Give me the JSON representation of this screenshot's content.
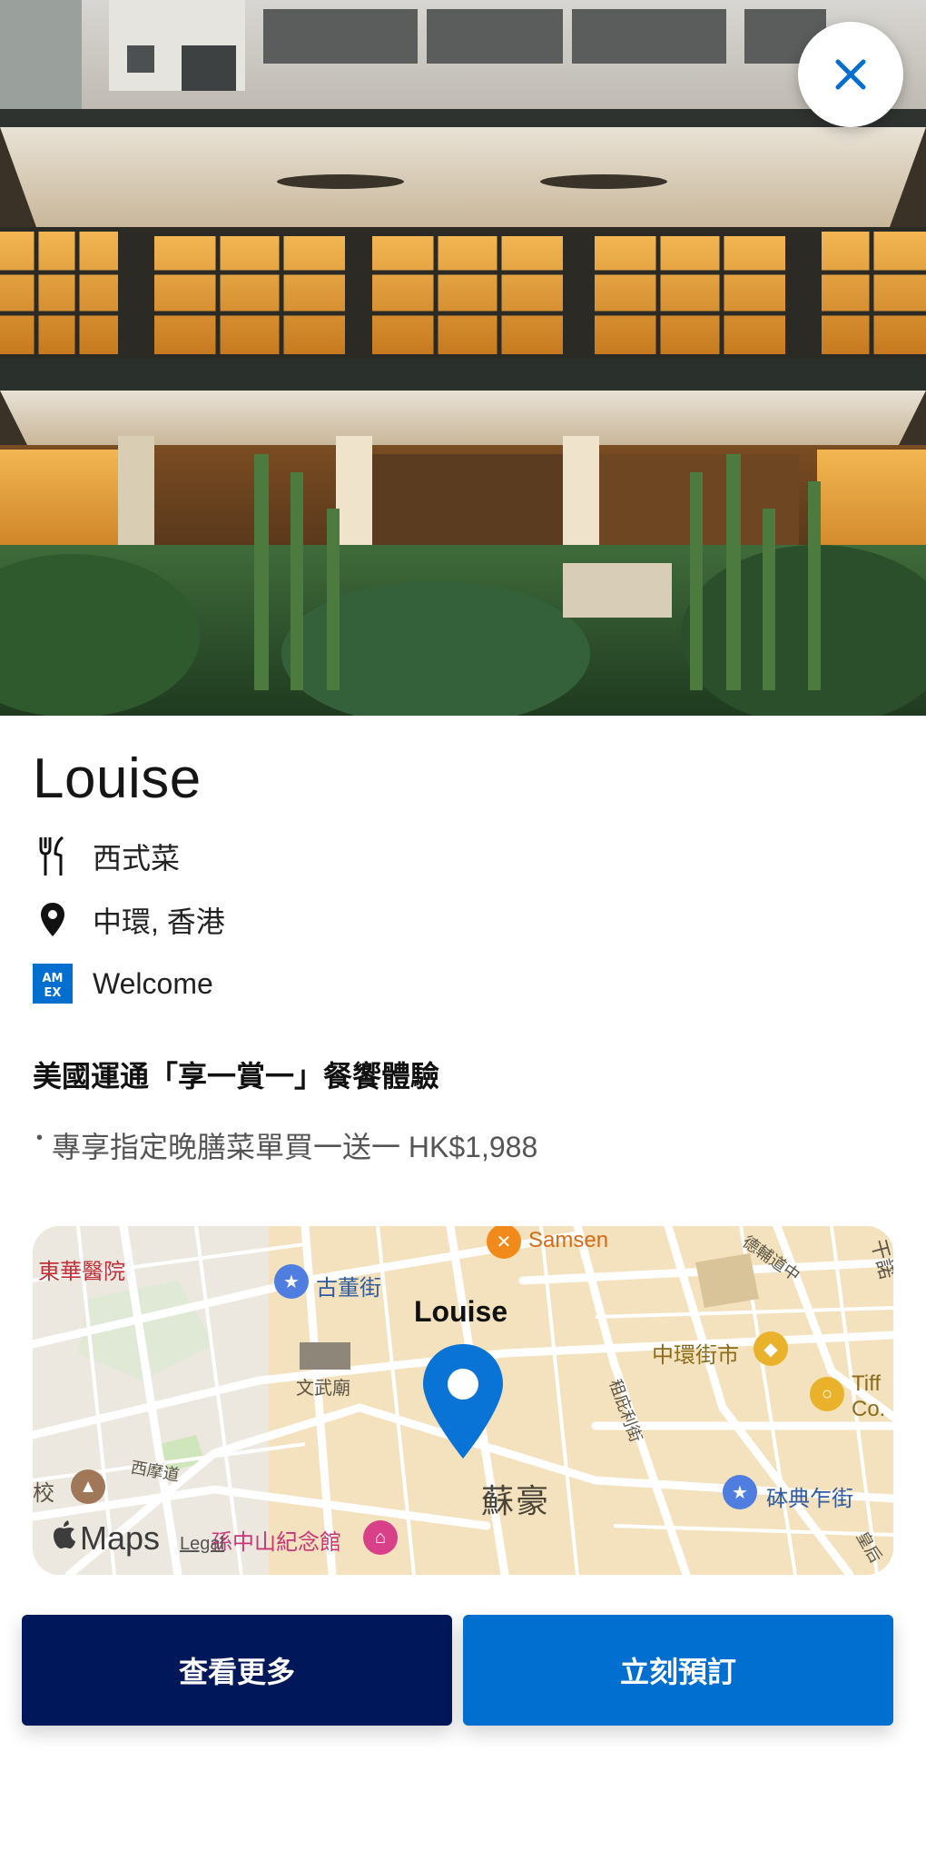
{
  "hero": {
    "image_alt": "restaurant-exterior-photo",
    "close_icon": "close-icon"
  },
  "restaurant": {
    "name": "Louise",
    "cuisine": "西式菜",
    "location": "中環, 香港",
    "card_program": "Welcome",
    "icons": {
      "cuisine": "fork-knife-icon",
      "location": "location-pin-icon",
      "card": "amex-logo-icon"
    }
  },
  "offer": {
    "title": "美國運通「享一賞一」餐饗體驗",
    "items": [
      "專享指定晚膳菜單買一送一 HK$1,988"
    ]
  },
  "map": {
    "pin_label": "Louise",
    "district": "蘇豪",
    "places": {
      "hospital": "東華醫院",
      "samsen": "Samsen",
      "gutongjie": "古董街",
      "temple": "文武廟",
      "central_market": "中環街市",
      "tiffany_line1": "Tiff",
      "tiffany_line2": "Co.",
      "western_street": "西摩道",
      "school": "校",
      "sun_yat_sen": "孫中山紀念館",
      "pedder": "砵典乍街",
      "road1": "德輔道中",
      "road2": "租庇利街",
      "road3": "皇后",
      "road4": "干諾"
    },
    "attribution": {
      "apple_glyph": "",
      "maps_word": "Maps",
      "legal": "Legal"
    },
    "colors": {
      "pin": "#0a74d6",
      "base": "#f3e2bd",
      "road": "#ffffff"
    }
  },
  "actions": {
    "more_label": "查看更多",
    "book_label": "立刻預訂"
  },
  "colors": {
    "amex_blue": "#006fcf",
    "amex_navy": "#00175a"
  }
}
